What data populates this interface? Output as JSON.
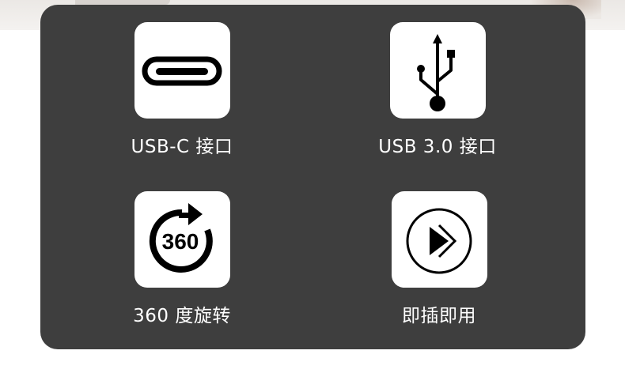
{
  "features": [
    {
      "label": "USB-C 接口",
      "icon": "usb-c-port-icon"
    },
    {
      "label": "USB 3.0 接口",
      "icon": "usb-symbol-icon"
    },
    {
      "label": "360 度旋转",
      "icon": "rotate-360-icon",
      "icon_text": "360"
    },
    {
      "label": "即插即用",
      "icon": "plug-and-play-icon"
    }
  ],
  "colors": {
    "panel": "#3e3e3e",
    "tile": "#ffffff",
    "icon": "#000000",
    "label": "#ffffff"
  }
}
